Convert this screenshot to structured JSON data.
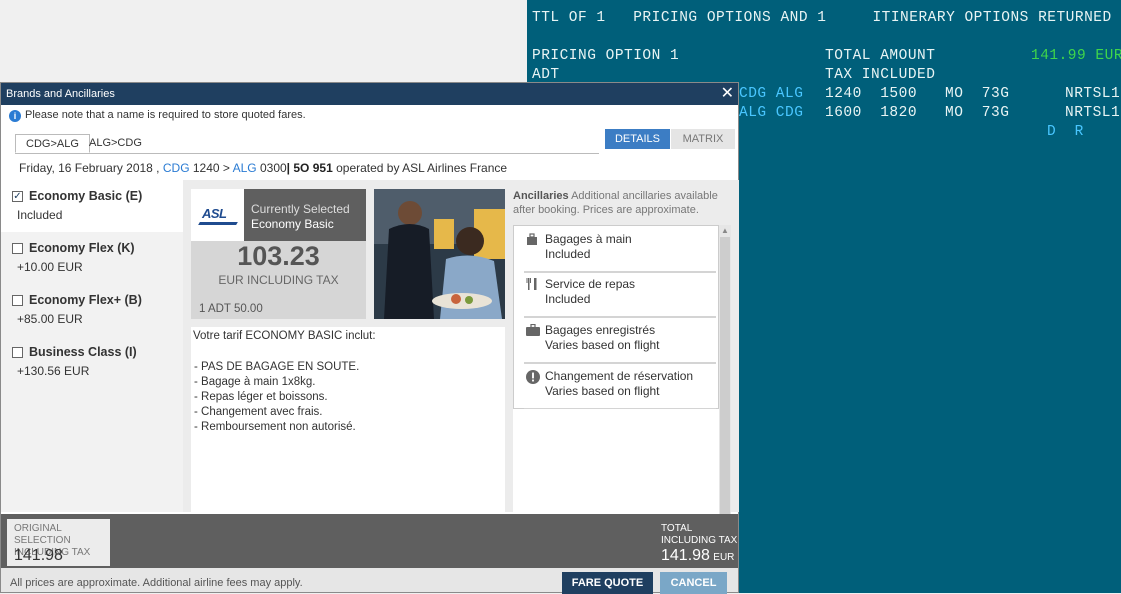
{
  "terminal": {
    "lines": [
      "TTL OF 1   PRICING OPTIONS AND 1     ITINERARY OPTIONS RETURNED",
      "PRICING OPTION 1",
      "TOTAL AMOUNT",
      "141.99 EUR",
      "ADT",
      "TAX INCLUDED",
      "CDG ALG",
      "1240  1500",
      "MO  73G",
      "NRTSL1",
      "ALG CDG",
      "1600  1820",
      "MO  73G",
      "NRTSL1",
      "D  R"
    ]
  },
  "dialog": {
    "title": "Brands and Ancillaries",
    "note": "Please note that a name is required to store quoted fares.",
    "tabs": [
      "CDG>ALG",
      "ALG>CDG"
    ],
    "view_toggle": {
      "details": "DETAILS",
      "matrix": "MATRIX"
    },
    "flight": {
      "date": "Friday, 16 February 2018 ,",
      "from": "CDG",
      "dep": "1240",
      "arrow": ">",
      "to": "ALG",
      "arr": "0300",
      "sep": "|",
      "flight_no": "5O  951",
      "operated": "operated by ASL Airlines France"
    },
    "fares": [
      {
        "name": "Economy Basic (E)",
        "price": "Included",
        "checked": true
      },
      {
        "name": "Economy Flex (K)",
        "price": "+10.00  EUR",
        "checked": false
      },
      {
        "name": "Economy Flex+ (B)",
        "price": "+85.00  EUR",
        "checked": false
      },
      {
        "name": "Business Class (I)",
        "price": "+130.56  EUR",
        "checked": false
      }
    ],
    "summary": {
      "logo_text": "ASL",
      "logo_sub": "AIRLINES",
      "current_label": "Currently Selected",
      "current_brand": "Economy Basic",
      "price": "103.23",
      "price_note": "EUR INCLUDING TAX",
      "pax": "1 ADT 50.00"
    },
    "description": {
      "heading": "Votre tarif ECONOMY BASIC inclut:",
      "items": [
        "-  PAS DE BAGAGE EN SOUTE.",
        "-  Bagage à main 1x8kg.",
        "-  Repas léger et boissons.",
        "-  Changement avec frais.",
        "-  Remboursement non autorisé."
      ]
    },
    "ancillaries": {
      "heading": "Ancillaries",
      "heading_note": "Additional ancillaries available after booking. Prices are approximate.",
      "items": [
        {
          "icon": "bag-icon",
          "name": "Bagages à main",
          "value": "Included"
        },
        {
          "icon": "cutlery-icon",
          "name": "Service de repas",
          "value": "Included"
        },
        {
          "icon": "suitcase-icon",
          "name": "Bagages enregistrés",
          "value": "Varies based on flight"
        },
        {
          "icon": "alert-icon",
          "name": "Changement de réservation",
          "value": "Varies based on flight"
        }
      ]
    },
    "footer": {
      "orig_label_1": "ORIGINAL SELECTION",
      "orig_label_2": "INCLUDING TAX",
      "orig_value": "141.98",
      "total_label_1": "TOTAL",
      "total_label_2": "INCLUDING TAX",
      "total_value": "141.98",
      "total_currency": "EUR",
      "disclaimer": "All prices are approximate. Additional airline fees may apply.",
      "fare_quote": "FARE QUOTE",
      "cancel": "CANCEL"
    }
  },
  "colors": {
    "terminal_bg": "#005f7a",
    "titlebar": "#1f3f60",
    "accent": "#3c7dc4",
    "amount_green": "#3fd64a"
  }
}
